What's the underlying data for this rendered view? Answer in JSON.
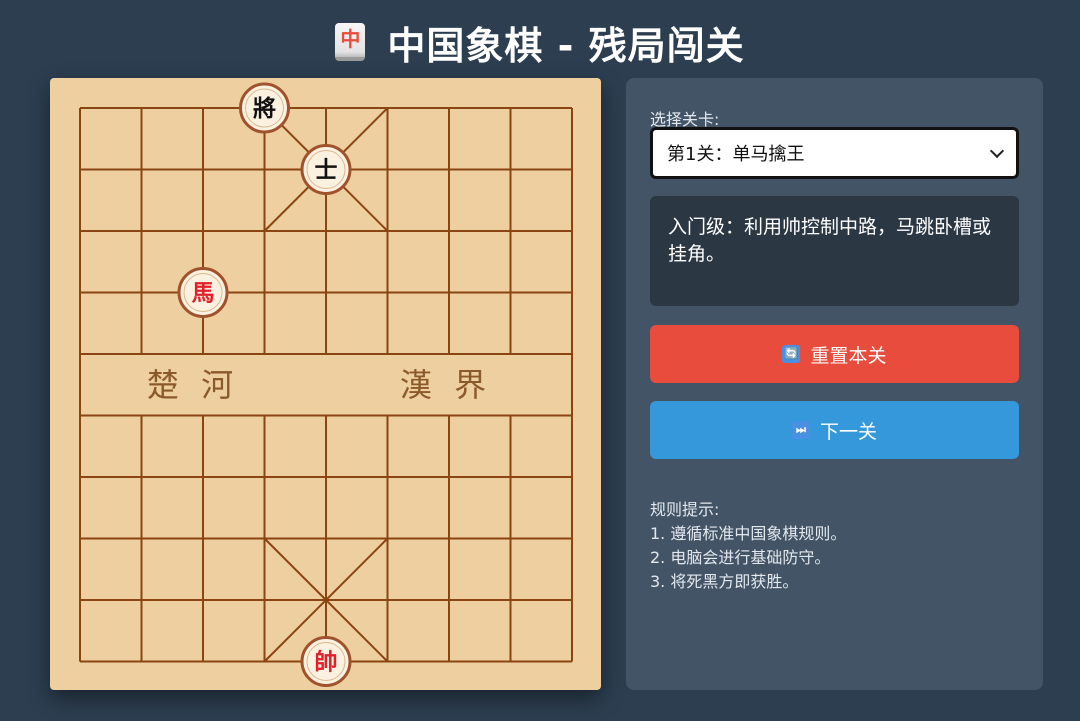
{
  "header": {
    "icon_glyph": "中",
    "icon_name": "mahjong-red-dragon-icon",
    "title": "中国象棋 - 残局闯关"
  },
  "board": {
    "river_left": "楚 河",
    "river_right": "漢 界",
    "colors": {
      "board_bg": "#eecf9f",
      "line": "#8b4513",
      "piece_face": "#fbf1e1",
      "piece_ring": "#a0522d",
      "red": "#e0202a",
      "black": "#111111"
    },
    "pieces": [
      {
        "char": "將",
        "side": "black",
        "col": 3,
        "row": 0
      },
      {
        "char": "士",
        "side": "black",
        "col": 4,
        "row": 1
      },
      {
        "char": "馬",
        "side": "red",
        "col": 2,
        "row": 3
      },
      {
        "char": "帥",
        "side": "red",
        "col": 4,
        "row": 9
      }
    ]
  },
  "sidebar": {
    "level_label": "选择关卡:",
    "level_selected": "第1关：单马擒王",
    "description": "入门级：利用帅控制中路，马跳卧槽或挂角。",
    "reset_label": "重置本关",
    "reset_icon": "🔄",
    "next_label": "下一关",
    "next_icon": "⏭",
    "rules_title": "规则提示:",
    "rules": [
      "1. 遵循标准中国象棋规则。",
      "2. 电脑会进行基础防守。",
      "3. 将死黑方即获胜。"
    ]
  }
}
